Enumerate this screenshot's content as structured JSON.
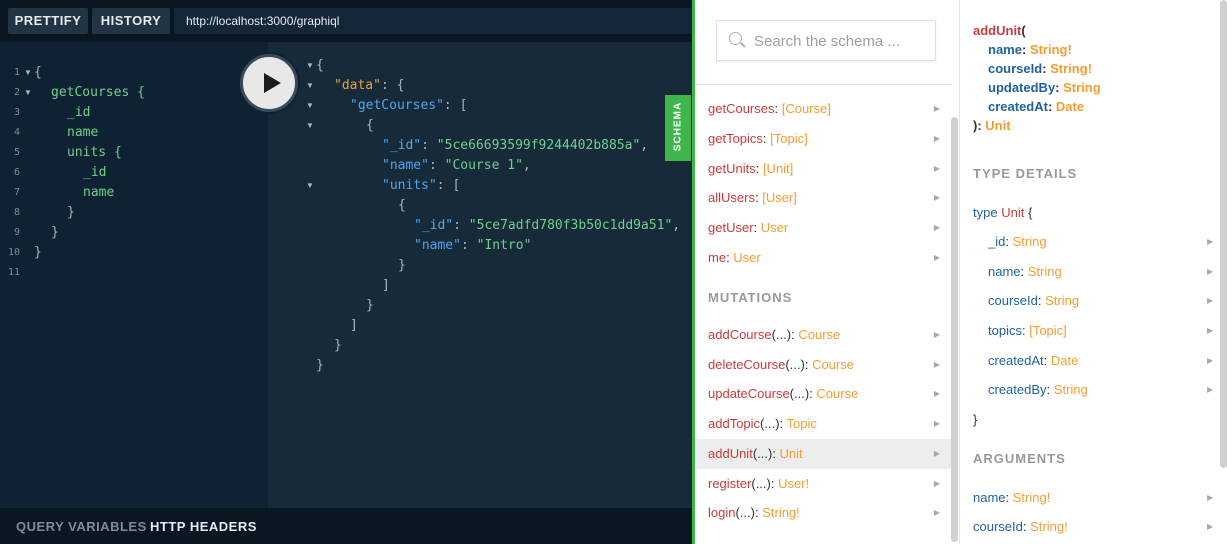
{
  "toolbar": {
    "prettify": "PRETTIFY",
    "history": "HISTORY",
    "url": "http://localhost:3000/graphiql"
  },
  "query": {
    "line_numbers": [
      "1",
      "2",
      "3",
      "4",
      "5",
      "6",
      "7",
      "8",
      "9",
      "10",
      "11"
    ],
    "lines": [
      "{",
      "getCourses {",
      "_id",
      "name",
      "units {",
      "_id",
      "name",
      "}",
      "}",
      "}",
      ""
    ]
  },
  "result": {
    "data_key": "\"data\"",
    "getCourses_key": "\"getCourses\"",
    "id_key": "\"_id\"",
    "id_val": "\"5ce66693599f9244402b885a\"",
    "name_key": "\"name\"",
    "name_val": "\"Course 1\"",
    "units_key": "\"units\"",
    "unit_id_val": "\"5ce7adfd780f3b50c1dd9a51\"",
    "unit_name_val": "\"Intro\""
  },
  "bottom": {
    "query_variables": "QUERY VARIABLES",
    "http_headers": "HTTP HEADERS"
  },
  "schema_tab": "SCHEMA",
  "explorer": {
    "search_placeholder": "Search the schema ...",
    "queries": [
      {
        "name": "getCourses",
        "type": "[Course]"
      },
      {
        "name": "getTopics",
        "type": "[Topic]"
      },
      {
        "name": "getUnits",
        "type": "[Unit]"
      },
      {
        "name": "allUsers",
        "type": "[User]"
      },
      {
        "name": "getUser",
        "type": "User"
      },
      {
        "name": "me",
        "type": "User"
      }
    ],
    "mutations_heading": "MUTATIONS",
    "mutations": [
      {
        "name": "addCourse",
        "args": "(...)",
        "type": "Course"
      },
      {
        "name": "deleteCourse",
        "args": "(...)",
        "type": "Course"
      },
      {
        "name": "updateCourse",
        "args": "(...)",
        "type": "Course"
      },
      {
        "name": "addTopic",
        "args": "(...)",
        "type": "Topic"
      },
      {
        "name": "addUnit",
        "args": "(...)",
        "type": "Unit"
      },
      {
        "name": "register",
        "args": "(...)",
        "type": "User!"
      },
      {
        "name": "login",
        "args": "(...)",
        "type": "String!"
      }
    ]
  },
  "details": {
    "signature_name": "addUnit",
    "signature_open": "(",
    "sig_args": [
      {
        "name": "name",
        "type": "String!"
      },
      {
        "name": "courseId",
        "type": "String!"
      },
      {
        "name": "updatedBy",
        "type": "String"
      },
      {
        "name": "createdAt",
        "type": "Date"
      }
    ],
    "signature_close": "):",
    "return_type": "Unit",
    "type_details_heading": "TYPE DETAILS",
    "type_kw": "type",
    "type_name": "Unit",
    "open_brace": "{",
    "close_brace": "}",
    "fields": [
      {
        "name": "_id",
        "type": "String"
      },
      {
        "name": "name",
        "type": "String"
      },
      {
        "name": "courseId",
        "type": "String"
      },
      {
        "name": "topics",
        "type": "[Topic]"
      },
      {
        "name": "createdAt",
        "type": "Date"
      },
      {
        "name": "createdBy",
        "type": "String"
      }
    ],
    "arguments_heading": "ARGUMENTS",
    "arguments": [
      {
        "name": "name",
        "type": "String!"
      },
      {
        "name": "courseId",
        "type": "String!"
      }
    ]
  },
  "colors": {
    "accent": "#3fb64c",
    "field": "#c93b3b",
    "type": "#f29d32",
    "dark_bg": "#0f2233"
  }
}
